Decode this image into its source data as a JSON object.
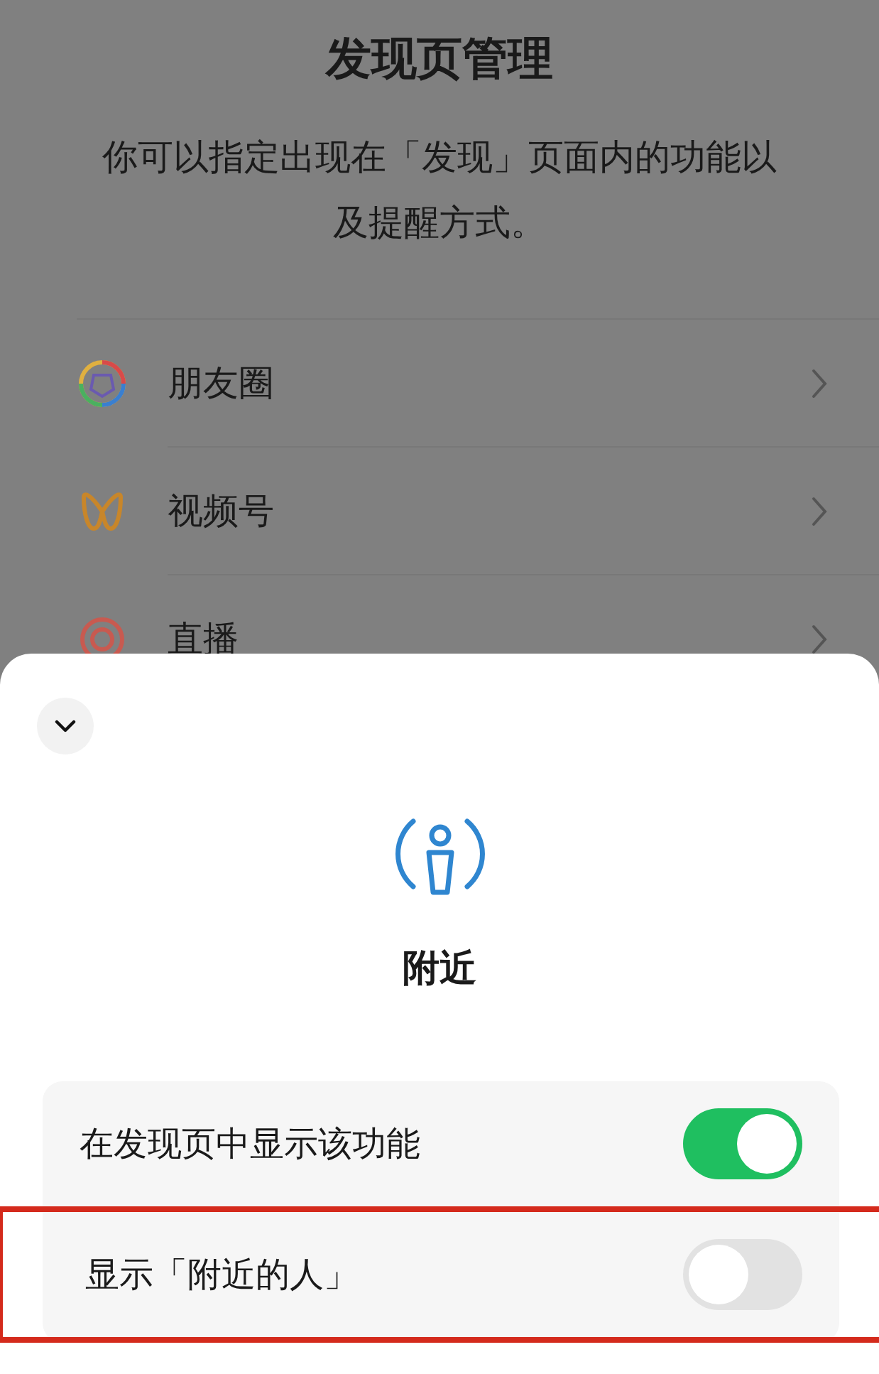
{
  "page": {
    "title": "发现页管理",
    "description": "你可以指定出现在「发现」页面内的功能以及提醒方式。",
    "items": [
      {
        "kind": "moments",
        "label": "朋友圈"
      },
      {
        "kind": "channels",
        "label": "视频号"
      },
      {
        "kind": "live",
        "label": "直播"
      }
    ]
  },
  "sheet": {
    "feature": "附近",
    "settings": [
      {
        "label": "在发现页中显示该功能",
        "on": true,
        "highlighted": false
      },
      {
        "label": "显示「附近的人」",
        "on": false,
        "highlighted": true
      }
    ]
  }
}
